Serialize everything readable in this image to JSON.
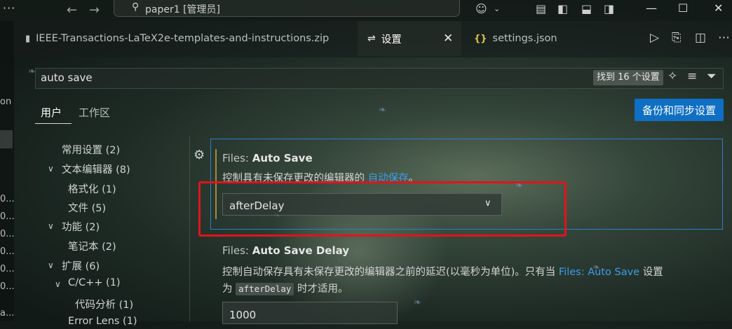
{
  "titlebar": {
    "more": "···",
    "back_icon": "arrow-left-icon",
    "forward_icon": "arrow-right-icon",
    "search_title": "paper1 [管理员]",
    "copilot_icon": "copilot-icon",
    "layout_icons": [
      "layout-customize-icon",
      "toggle-sidebar-icon",
      "toggle-panel-icon",
      "toggle-secondary-sidebar-icon"
    ],
    "window_buttons": [
      "minimize-icon",
      "maximize-icon",
      "close-icon"
    ]
  },
  "tabs": [
    {
      "label": "IEEE-Transactions-LaTeX2e-templates-and-instructions.zip",
      "icon": "file-zip-icon"
    },
    {
      "label": "设置",
      "icon": "settings-sliders-icon"
    },
    {
      "label": "settings.json",
      "icon": "json-braces-icon"
    }
  ],
  "editor_actions": [
    "run-icon",
    "open-settings-json-icon",
    "split-editor-icon",
    "more-actions-icon"
  ],
  "left_strip": {
    "fragments": [
      "on",
      "0...",
      "0...",
      "0...",
      "0...",
      "0...",
      "0...",
      "a..."
    ]
  },
  "search": {
    "value": "auto save",
    "result_count": "找到 16 个设置",
    "icons": [
      "sparkle-icon",
      "clear-filter-icon",
      "filter-icon"
    ]
  },
  "scopes": {
    "user": "用户",
    "workspace": "工作区"
  },
  "backup_button": "备份和同步设置",
  "toc": [
    {
      "label": "常用设置 (2)",
      "expanded": null
    },
    {
      "label": "文本编辑器 (8)",
      "expanded": true
    },
    {
      "label": "格式化 (1)",
      "expanded": null
    },
    {
      "label": "文件 (5)",
      "expanded": null
    },
    {
      "label": "功能 (2)",
      "expanded": true
    },
    {
      "label": "笔记本 (2)",
      "expanded": null
    },
    {
      "label": "扩展 (6)",
      "expanded": true
    },
    {
      "label": "C/C++ (1)",
      "expanded": true
    },
    {
      "label": "代码分析 (1)",
      "expanded": null
    },
    {
      "label": "Error Lens (1)",
      "expanded": null
    }
  ],
  "settings": [
    {
      "category": "Files: ",
      "name": "Auto Save",
      "desc_prefix": "控制具有未保存更改的编辑器的 ",
      "desc_link": "自动保存",
      "desc_suffix": "。",
      "value": "afterDelay",
      "modified": true
    },
    {
      "category": "Files: ",
      "name": "Auto Save Delay",
      "desc_line1_prefix": "控制自动保存具有未保存更改的编辑器之前的延迟(以毫秒为单位)。只有当 ",
      "desc_link": "Files: Auto Save",
      "desc_line1_suffix": " 设置",
      "desc_line2_prefix": "为 ",
      "desc_code": "afterDelay",
      "desc_line2_suffix": " 时才适用。",
      "value": "1000"
    }
  ],
  "colors": {
    "accent": "#0f6fc4",
    "focus_border": "#2f7fc8",
    "annotation": "#e0141c",
    "link": "#3f9ce8",
    "modified_bar": "#a58a3c"
  }
}
